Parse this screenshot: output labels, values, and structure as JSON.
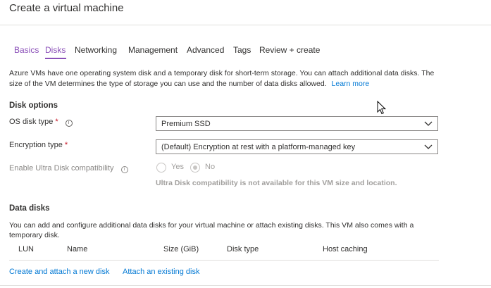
{
  "header": {
    "title": "Create a virtual machine"
  },
  "tabs": [
    {
      "label": "Basics"
    },
    {
      "label": "Disks"
    },
    {
      "label": "Networking"
    },
    {
      "label": "Management"
    },
    {
      "label": "Advanced"
    },
    {
      "label": "Tags"
    },
    {
      "label": "Review + create"
    }
  ],
  "intro": {
    "text": "Azure VMs have one operating system disk and a temporary disk for short-term storage. You can attach additional data disks. The size of the VM determines the type of storage you can use and the number of data disks allowed.",
    "learn_more": "Learn more"
  },
  "disk_options": {
    "title": "Disk options",
    "os_disk_type": {
      "label": "OS disk type",
      "required_mark": "*",
      "value": "Premium SSD"
    },
    "encryption_type": {
      "label": "Encryption type",
      "required_mark": "*",
      "value": "(Default) Encryption at rest with a platform-managed key"
    },
    "ultra_disk": {
      "label": "Enable Ultra Disk compatibility",
      "options": [
        "Yes",
        "No"
      ],
      "selected": "No",
      "note": "Ultra Disk compatibility is not available for this VM size and location."
    }
  },
  "data_disks": {
    "title": "Data disks",
    "description": "You can add and configure additional data disks for your virtual machine or attach existing disks. This VM also comes with a temporary disk.",
    "columns": [
      "LUN",
      "Name",
      "Size (GiB)",
      "Disk type",
      "Host caching"
    ],
    "create_link": "Create and attach a new disk",
    "attach_link": "Attach an existing disk"
  },
  "colors": {
    "accent": "#8a4fb8",
    "link": "#0078d4",
    "required": "#c50f1f"
  }
}
